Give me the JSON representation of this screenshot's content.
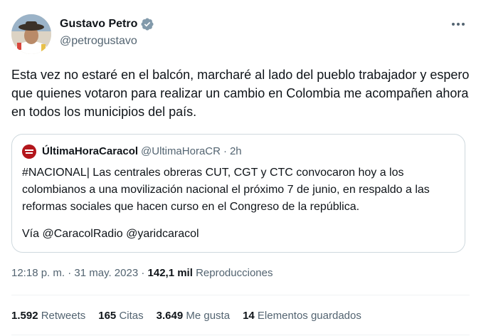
{
  "author": {
    "name": "Gustavo Petro",
    "handle": "@petrogustavo"
  },
  "tweet_text": "Esta vez no estaré en el balcón, marcharé al lado del pueblo trabajador y espero que quienes votaron para realizar un cambio en Colombia me acompañen ahora en todos los municipios del país.",
  "quote": {
    "name": "ÚltimaHoraCaracol",
    "handle": "@UltimaHoraCR",
    "separator": "·",
    "time": "2h",
    "text": "#NACIONAL| Las centrales obreras CUT, CGT y CTC convocaron hoy a los colombianos a una movilización nacional el próximo 7 de junio, en respaldo a las reformas sociales que hacen curso en el Congreso de la república.",
    "via": "Vía @CaracolRadio @yaridcaracol"
  },
  "meta": {
    "time": "12:18 p. m.",
    "separator": "·",
    "date": "31 may. 2023",
    "views_count": "142,1 mil",
    "views_label": "Reproducciones"
  },
  "stats": {
    "retweets_count": "1.592",
    "retweets_label": "Retweets",
    "quotes_count": "165",
    "quotes_label": "Citas",
    "likes_count": "3.649",
    "likes_label": "Me gusta",
    "bookmarks_count": "14",
    "bookmarks_label": "Elementos guardados"
  },
  "colors": {
    "verified_badge": "#829aab",
    "secondary_text": "#536471",
    "border": "#cfd9de",
    "quote_avatar": "#b3161c"
  },
  "icons": {
    "verified": "verified-badge-icon",
    "more": "more-options-icon"
  }
}
